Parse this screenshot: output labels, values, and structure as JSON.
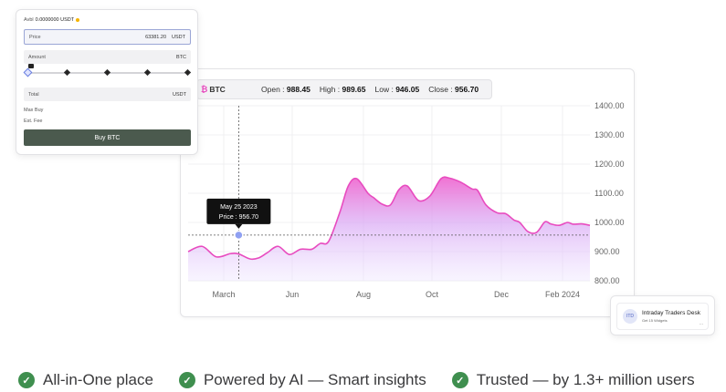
{
  "order_panel": {
    "avbl_label": "Avbl",
    "avbl_value": "0.0000000 USDT",
    "price_label": "Price",
    "price_value": "63381.20",
    "price_unit": "USDT",
    "amount_label": "Amount",
    "amount_unit": "BTC",
    "slider_percent": 0,
    "total_label": "Total",
    "total_unit": "USDT",
    "max_buy_label": "Max Buy",
    "est_fee_label": "Est. Fee",
    "buy_button_label": "Buy BTC"
  },
  "ohlc": {
    "symbol": "BTC",
    "open_label": "Open :",
    "open_value": "988.45",
    "high_label": "High :",
    "high_value": "989.65",
    "low_label": "Low :",
    "low_value": "946.05",
    "close_label": "Close :",
    "close_value": "956.70"
  },
  "tooltip": {
    "date": "May 25 2023",
    "price": "Price : 956.70"
  },
  "chart_data": {
    "type": "area",
    "x_ticks": [
      "March",
      "Jun",
      "Aug",
      "Oct",
      "Dec",
      "Feb 2024"
    ],
    "y_ticks": [
      "1400.00",
      "1300.00",
      "1200.00",
      "1100.00",
      "1000.00",
      "900.00",
      "800.00"
    ],
    "ylim": [
      800,
      1400
    ],
    "grid": true,
    "line_color": "#e84bbf",
    "x": [
      0,
      5,
      10,
      15,
      18,
      22,
      25,
      28,
      32,
      36,
      40,
      44,
      47,
      50,
      54,
      57,
      60,
      64,
      66,
      69,
      72,
      75,
      78,
      82,
      86,
      90,
      93,
      97,
      101,
      103,
      106,
      110,
      113,
      116,
      118,
      121,
      124,
      127,
      129,
      132,
      135,
      137,
      140,
      143
    ],
    "values": [
      900,
      918,
      882,
      893,
      892,
      875,
      878,
      895,
      918,
      890,
      908,
      908,
      928,
      935,
      1035,
      1125,
      1150,
      1100,
      1085,
      1063,
      1060,
      1112,
      1125,
      1075,
      1090,
      1150,
      1152,
      1138,
      1115,
      1110,
      1060,
      1033,
      1030,
      1008,
      1000,
      968,
      966,
      1002,
      995,
      990,
      1000,
      994,
      995,
      990
    ],
    "crosshair": {
      "x_index": 4,
      "value": 956.7,
      "label_date": "May 25 2023"
    }
  },
  "widget": {
    "avatar_text": "ITD",
    "title": "Intraday Traders Desk",
    "subtitle": "Get 15 Widgets",
    "more": "..."
  },
  "features": [
    {
      "label": "All-in-One place"
    },
    {
      "label": "Powered by AI — Smart insights"
    },
    {
      "label": "Trusted — by 1.3+ million users"
    }
  ],
  "colors": {
    "check": "#3f8f4f",
    "buy_button": "#4b5a4e",
    "accent": "#e84bbf"
  }
}
